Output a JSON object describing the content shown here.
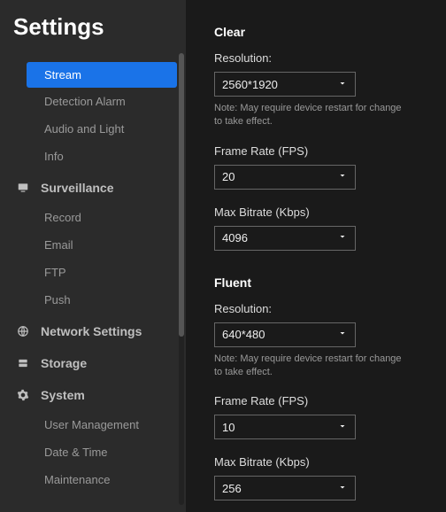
{
  "title": "Settings",
  "sidebar": {
    "groups": [
      {
        "icon": "camera-icon",
        "label": "",
        "items": [
          {
            "label": "Stream",
            "active": true
          },
          {
            "label": "Detection Alarm"
          },
          {
            "label": "Audio and Light"
          },
          {
            "label": "Info"
          }
        ]
      },
      {
        "icon": "monitor-icon",
        "label": "Surveillance",
        "items": [
          {
            "label": "Record"
          },
          {
            "label": "Email"
          },
          {
            "label": "FTP"
          },
          {
            "label": "Push"
          }
        ]
      },
      {
        "icon": "globe-icon",
        "label": "Network Settings",
        "items": []
      },
      {
        "icon": "storage-icon",
        "label": "Storage",
        "items": []
      },
      {
        "icon": "gear-icon",
        "label": "System",
        "items": [
          {
            "label": "User Management"
          },
          {
            "label": "Date & Time"
          },
          {
            "label": "Maintenance"
          }
        ]
      }
    ]
  },
  "content": {
    "streams": [
      {
        "title": "Clear",
        "resolution_label": "Resolution:",
        "resolution_value": "2560*1920",
        "note": "Note: May require device restart for change to take effect.",
        "fps_label": "Frame Rate (FPS)",
        "fps_value": "20",
        "bitrate_label": "Max Bitrate (Kbps)",
        "bitrate_value": "4096"
      },
      {
        "title": "Fluent",
        "resolution_label": "Resolution:",
        "resolution_value": "640*480",
        "note": "Note: May require device restart for change to take effect.",
        "fps_label": "Frame Rate (FPS)",
        "fps_value": "10",
        "bitrate_label": "Max Bitrate (Kbps)",
        "bitrate_value": "256"
      }
    ]
  }
}
